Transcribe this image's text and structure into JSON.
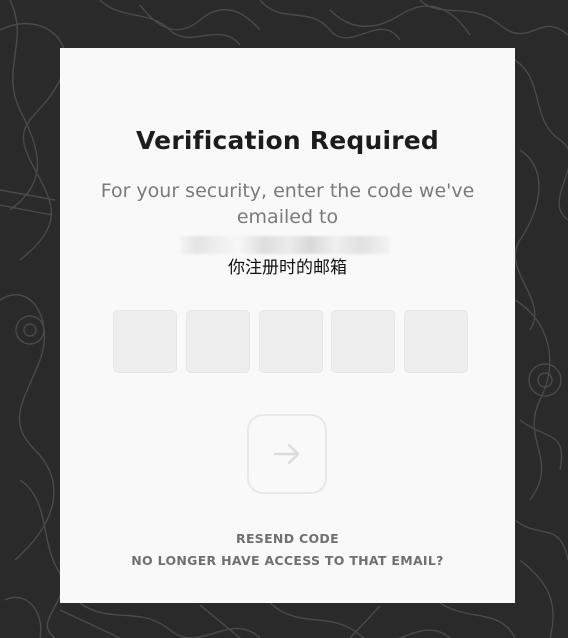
{
  "dialog": {
    "title": "Verification Required",
    "subtitle": "For your security, enter the code we've emailed to",
    "email_note": "你注册时的邮箱"
  },
  "code_inputs": [
    {
      "value": ""
    },
    {
      "value": ""
    },
    {
      "value": ""
    },
    {
      "value": ""
    },
    {
      "value": ""
    }
  ],
  "submit": {
    "icon": "arrow-right-icon"
  },
  "links": {
    "resend": "RESEND CODE",
    "no_access": "NO LONGER HAVE ACCESS TO THAT EMAIL?"
  },
  "colors": {
    "background": "#2b2b2b",
    "card": "#f9f9f9",
    "title": "#1c1c1c",
    "subtitle": "#7a7a7a",
    "input_fill": "#eeeeee",
    "link": "#707070"
  }
}
